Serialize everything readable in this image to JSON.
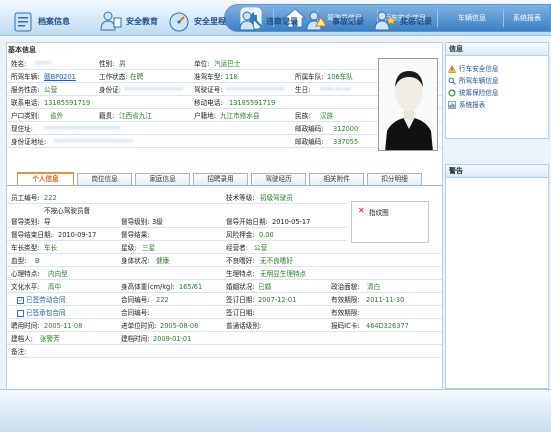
{
  "nav": {
    "links": [
      "驾驶员信息",
      "行车安全信息",
      "车辆信息",
      "系统报表"
    ]
  },
  "section_title": "基本信息",
  "basic": {
    "r1": {
      "l1": "姓名:",
      "v1": "*****",
      "l2": "性别:",
      "v2": "男",
      "l3": "单位:",
      "v3": "汽运巴士"
    },
    "r2": {
      "l1": "所驾车辆:",
      "v1": "赣BP0201",
      "l2": "工作状态:",
      "v2": "在聘",
      "l3": "准驾车型:",
      "v3": "118",
      "l4": "所属车队:",
      "v4": "106车队"
    },
    "r3": {
      "l1": "服务性质:",
      "v1": "公营",
      "l2": "身份证:",
      "v2": "******************",
      "l3": "驾驶证号:",
      "v3": "******************",
      "l4": "生日:",
      "v4": "****-**-**"
    },
    "r4": {
      "l1": "联系电话:",
      "v1": "13185591719",
      "l2": "移动电话:",
      "v2": "13185591719"
    },
    "r5": {
      "l1": "户口类别:",
      "v1": "省外",
      "l2": "籍贯:",
      "v2": "江西省九江",
      "l3": "户籍地:",
      "v3": "九江市修水县",
      "l4": "民族:",
      "v4": "汉族"
    },
    "r6": {
      "l1": "现住址:",
      "v1": "***********************",
      "l2": "邮政编码:",
      "v2": "312000"
    },
    "r7": {
      "l1": "身份证地址:",
      "v1": "************************",
      "l2": "邮政编码:",
      "v2": "337055"
    }
  },
  "tabs": [
    "个人信息",
    "岗位信息",
    "家庭信息",
    "招聘录用",
    "驾驶经历",
    "相关附件",
    "扣分明细"
  ],
  "personal": {
    "r1": {
      "l1": "员工编号:",
      "v1": "222",
      "l2": "技术等级:",
      "v2": "初级驾驶员"
    },
    "r2a": "不按心驾驶员督",
    "r2": {
      "l1": "督导类别:",
      "v1": "导",
      "l2": "督导级别:",
      "v2": "3级",
      "l3": "督导开始日期:",
      "v3": "2010-05-17"
    },
    "r3": {
      "l1": "督导结束日期:",
      "v1": "2010-09-17",
      "l2": "督导结果:",
      "v2": "",
      "l3": "风险押金:",
      "v3": "0.00"
    },
    "r4": {
      "l1": "车长类型:",
      "v1": "车长",
      "l2": "星级:",
      "v2": "三星",
      "l3": "经营者:",
      "v3": "公营"
    },
    "r5": {
      "l1": "血型:",
      "v1": "B",
      "l2": "身体状况:",
      "v2": "健康",
      "l3": "不良嗜好:",
      "v3": "无不良嗜好"
    },
    "r6": {
      "l1": "心理特点:",
      "v1": "内向型",
      "l2": "生理特点:",
      "v2": "无明显生理特点"
    },
    "r7": {
      "l1": "文化水平:",
      "v1": "高中",
      "l2": "身高体重(cm/kg):",
      "v2": "165/61",
      "l3": "婚姻状况:",
      "v3": "已婚",
      "l4": "政治面貌:",
      "v4": "清白"
    },
    "r8": {
      "l1": "已签劳动合同",
      "l2": "合同编号:",
      "v2": "222",
      "l3": "签订日期:",
      "v3": "2007-12-01",
      "l4": "有效期限:",
      "v4": "2011-11-30"
    },
    "r9": {
      "l1": "已签承包合同",
      "l2": "合同编号:",
      "v2": "",
      "l3": "签订日期:",
      "v3": "",
      "l4": "有效期限:",
      "v4": ""
    },
    "r10": {
      "l1": "聘用时间:",
      "v1": "2005-11-08",
      "l2": "进单位时间:",
      "v2": "2005-08-08",
      "l3": "普通话级别:",
      "v3": "",
      "l4": "报码IC卡:",
      "v4": "464D326377"
    },
    "r11": {
      "l1": "建档人:",
      "v1": "张警芳",
      "l2": "建档时间:",
      "v2": "2009-01-01"
    },
    "r12": {
      "l1": "备注:",
      "v1": ""
    }
  },
  "fingerprint": {
    "label": "指纹图"
  },
  "side": {
    "info_title": "信息",
    "items": [
      "行车安全信息",
      "所驾车辆信息",
      "统筹保险信息",
      "系统报表"
    ],
    "alert_title": "警告"
  },
  "bottom": [
    "档案信息",
    "安全教育",
    "安全里程",
    "违章记录",
    "事故记录",
    "奖惩记录"
  ]
}
